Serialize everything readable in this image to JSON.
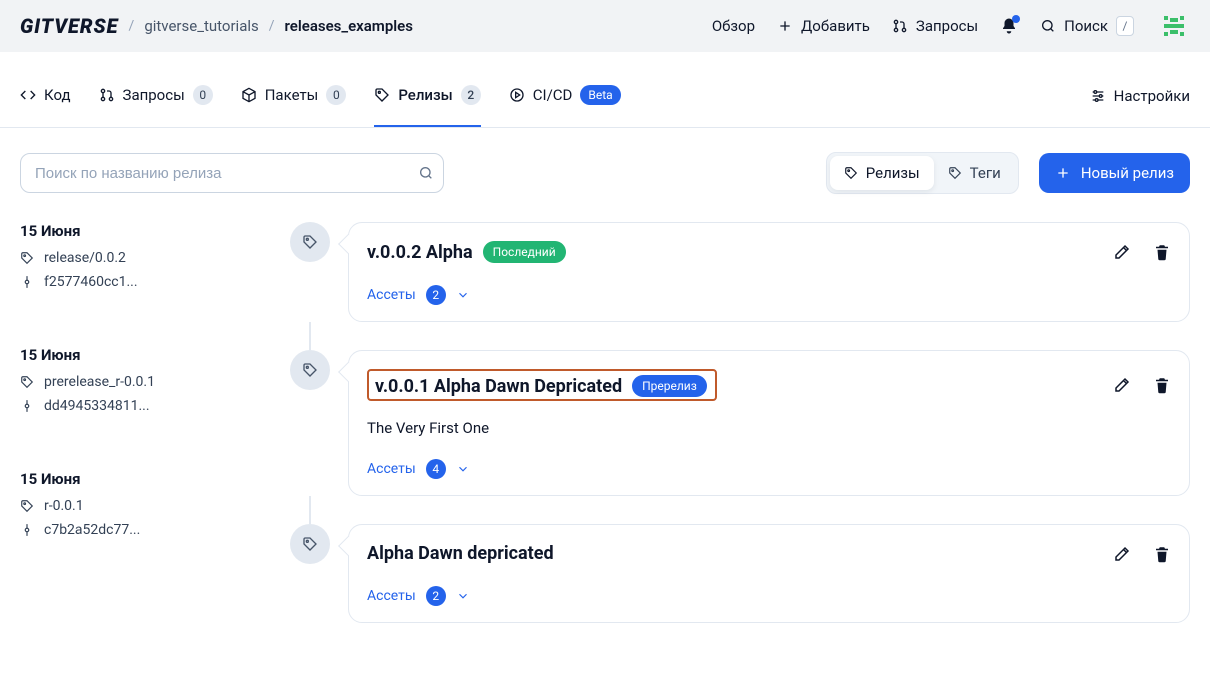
{
  "header": {
    "logo_text": "GITVERSE",
    "breadcrumbs": [
      "gitverse_tutorials",
      "releases_examples"
    ],
    "nav": {
      "overview": "Обзор",
      "add": "Добавить",
      "requests": "Запросы",
      "search": "Поиск",
      "search_key": "/"
    }
  },
  "tabs": {
    "code": "Код",
    "requests": {
      "label": "Запросы",
      "count": "0"
    },
    "packages": {
      "label": "Пакеты",
      "count": "0"
    },
    "releases": {
      "label": "Релизы",
      "count": "2"
    },
    "cicd": {
      "label": "CI/CD",
      "badge": "Beta"
    },
    "settings": "Настройки"
  },
  "toolbar": {
    "search_placeholder": "Поиск по названию релиза",
    "seg": {
      "releases": "Релизы",
      "tags": "Теги"
    },
    "new_release": "Новый релиз"
  },
  "sidebar": [
    {
      "date": "15 Июня",
      "tag": "release/0.0.2",
      "commit": "f2577460cc1..."
    },
    {
      "date": "15 Июня",
      "tag": "prerelease_r-0.0.1",
      "commit": "dd4945334811..."
    },
    {
      "date": "15 Июня",
      "tag": "r-0.0.1",
      "commit": "c7b2a52dc77..."
    }
  ],
  "releases": [
    {
      "title": "v.0.0.2 Alpha",
      "status_label": "Последний",
      "status_kind": "green",
      "desc": "",
      "assets_label": "Ассеты",
      "assets_count": "2"
    },
    {
      "title": "v.0.0.1 Alpha Dawn Depricated",
      "status_label": "Пререлиз",
      "status_kind": "blue",
      "highlighted": true,
      "desc": "The Very First One",
      "assets_label": "Ассеты",
      "assets_count": "4"
    },
    {
      "title": "Alpha Dawn depricated",
      "status_label": "",
      "status_kind": "",
      "desc": "",
      "assets_label": "Ассеты",
      "assets_count": "2"
    }
  ]
}
